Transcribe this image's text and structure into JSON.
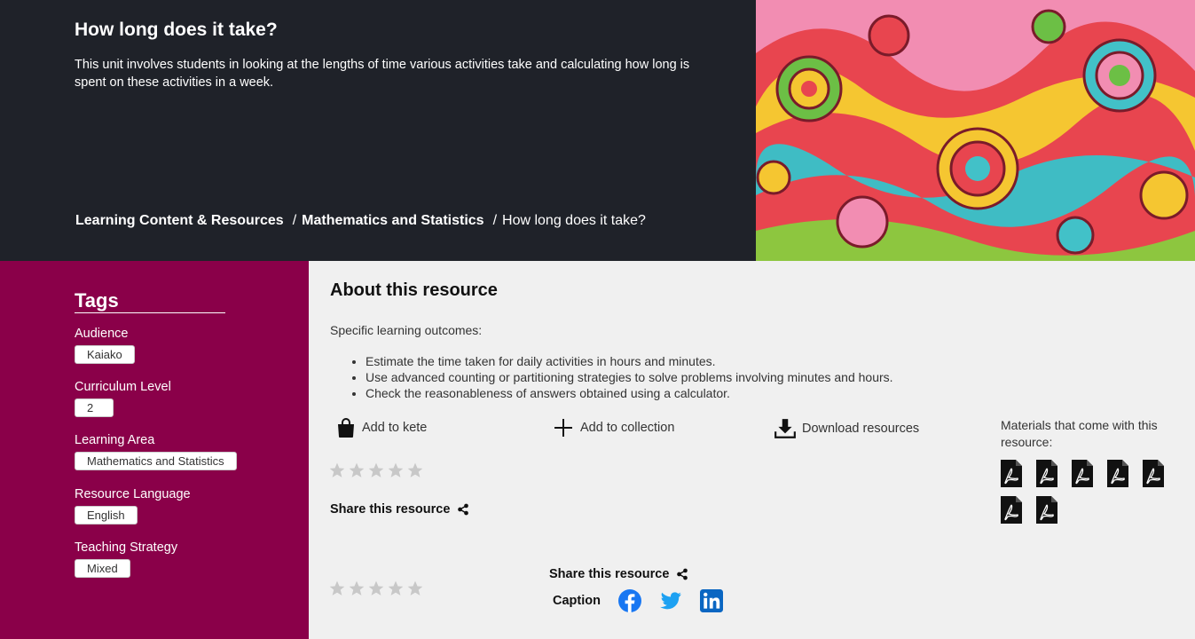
{
  "hero": {
    "title": "How long does it take?",
    "description": "This unit involves students in looking at the lengths of time various activities take and calculating how long is spent on these activities in a week.",
    "breadcrumb": {
      "items": [
        "Learning Content & Resources",
        "Mathematics and Statistics"
      ],
      "current": "How long does it take?",
      "separator": "/"
    }
  },
  "sidebar": {
    "heading": "Tags",
    "groups": [
      {
        "label": "Audience",
        "value": "Kaiako"
      },
      {
        "label": "Curriculum Level",
        "value": "2"
      },
      {
        "label": "Learning Area",
        "value": "Mathematics and Statistics"
      },
      {
        "label": "Resource Language",
        "value": "English"
      },
      {
        "label": "Teaching Strategy",
        "value": "Mixed"
      }
    ]
  },
  "main": {
    "title": "About this resource",
    "outcomes_label": "Specific learning outcomes:",
    "outcomes": [
      "Estimate the time taken for daily activities in hours and minutes.",
      "Use advanced counting or partitioning strategies to solve problems involving minutes and hours.",
      "Check the reasonableness of answers obtained using a calculator."
    ],
    "actions": {
      "add_kete": "Add to kete",
      "add_collection": "Add to collection",
      "download": "Download resources"
    },
    "share_label": "Share this resource",
    "materials_label": "Materials that come with this resource:",
    "pdf_count": 7,
    "caption_label": "Caption",
    "rating": {
      "value": 0,
      "max": 5
    }
  },
  "colors": {
    "hero_bg": "#1f2229",
    "sidebar_bg": "#8a0049",
    "main_bg": "#f0f0f0",
    "star_empty": "#c8c8c8",
    "facebook": "#1877f2",
    "twitter": "#1da1f2",
    "linkedin": "#0a66c2"
  },
  "icons": {
    "kete": "shopping-bag-icon",
    "collection": "plus-icon",
    "download": "download-icon",
    "share": "share-icon",
    "pdf": "pdf-file-icon",
    "facebook": "facebook-icon",
    "twitter": "twitter-icon",
    "linkedin": "linkedin-icon",
    "star": "star-icon"
  }
}
